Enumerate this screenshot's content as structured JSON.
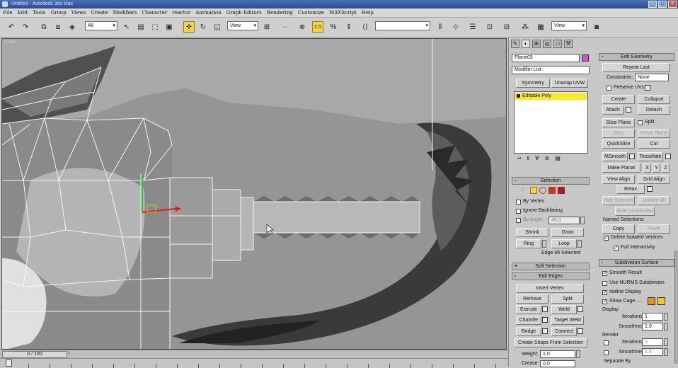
{
  "window": {
    "title": "Untitled - Autodesk 3ds Max"
  },
  "menu": [
    "File",
    "Edit",
    "Tools",
    "Group",
    "Views",
    "Create",
    "Modifiers",
    "Character",
    "reactor",
    "Animation",
    "Graph Editors",
    "Rendering",
    "Customize",
    "MAXScript",
    "Help"
  ],
  "toolbar": {
    "selection_filter": "All",
    "ref_coord": "View",
    "named_selection": "",
    "view_dropdown": "View",
    "snap_label": "2.5",
    "percent_snap": "%"
  },
  "viewport": {
    "label": "Front",
    "cursor_hint": ""
  },
  "timeline": {
    "slider_text": "0 / 100"
  },
  "command_panel": {
    "object_name": "Plane03",
    "modifier_list": "Modifier List",
    "symmetry_button": "Symmetry",
    "unwrap_button": "Unwrap UVW",
    "stack_item": "Editable Poly",
    "object_color": "#d44fd4"
  },
  "selection": {
    "header": "Selection",
    "by_vertex": "By Vertex",
    "ignore_backfacing": "Ignore Backfacing",
    "by_angle": "By Angle:",
    "angle_value": "45.0",
    "shrink": "Shrink",
    "grow": "Grow",
    "ring": "Ring",
    "loop": "Loop",
    "status": "Edge 99 Selected"
  },
  "soft_selection": {
    "header": "Soft Selection"
  },
  "edit_edges": {
    "header": "Edit Edges",
    "insert_vertex": "Insert Vertex",
    "remove": "Remove",
    "split": "Split",
    "extrude": "Extrude",
    "weld": "Weld",
    "chamfer": "Chamfer",
    "target_weld": "Target Weld",
    "bridge": "Bridge",
    "connect": "Connect",
    "create_shape": "Create Shape From Selection",
    "weight_label": "Weight:",
    "weight_value": "1.0",
    "crease_label": "Crease:",
    "crease_value": "0.0"
  },
  "edit_geometry": {
    "header": "Edit Geometry",
    "repeat_last": "Repeat Last",
    "constraints_label": "Constraints:",
    "constraints_value": "None",
    "preserve_uvs": "Preserve UVs",
    "create": "Create",
    "collapse": "Collapse",
    "attach": "Attach",
    "detach": "Detach",
    "slice_plane": "Slice Plane",
    "split": "Split",
    "slice": "Slice",
    "reset_plane": "Reset Plane",
    "quickslice": "QuickSlice",
    "cut": "Cut",
    "msmooth": "MSmooth",
    "tessellate": "Tessellate",
    "make_planar": "Make Planar",
    "x": "X",
    "y": "Y",
    "z": "Z",
    "view_align": "View Align",
    "grid_align": "Grid Align",
    "relax": "Relax",
    "hide_selected": "Hide Selected",
    "unhide_all": "Unhide All",
    "hide_unselected": "Hide Unselected",
    "named_selections": "Named Selections:",
    "copy": "Copy",
    "paste": "Paste",
    "delete_isolated": "Delete Isolated Vertices",
    "full_interactivity": "Full Interactivity"
  },
  "subdivision": {
    "header": "Subdivision Surface",
    "smooth_result": "Smooth Result",
    "use_nurms": "Use NURMS Subdivision",
    "isoline_display": "Isoline Display",
    "show_cage": "Show Cage......",
    "cage_color1": "#e8921a",
    "cage_color2": "#f2c81a",
    "display_label": "Display",
    "iterations_label": "Iterations:",
    "iterations_value": "1",
    "smoothness_label": "Smoothness:",
    "smoothness_value": "1.0",
    "render_label": "Render",
    "r_iterations_value": "0",
    "r_smoothness_value": "1.0",
    "separate_by": "Separate By"
  }
}
